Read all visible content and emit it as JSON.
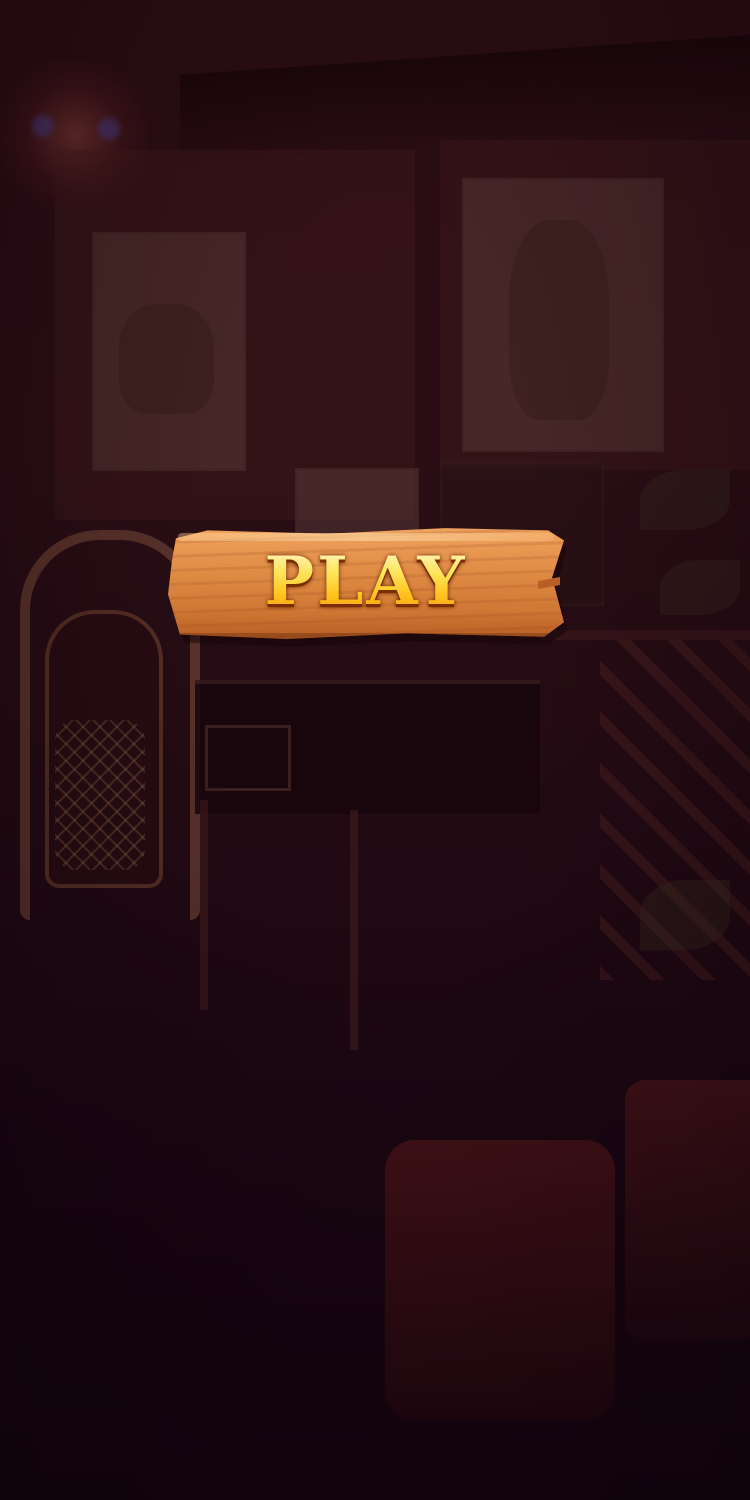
{
  "play_button": {
    "label": "PLAY"
  },
  "colors": {
    "background": "#2a0d14",
    "wood_light": "#f0a45e",
    "wood_dark": "#b85f25",
    "label_top": "#fffbe0",
    "label_bottom": "#f0901a"
  }
}
